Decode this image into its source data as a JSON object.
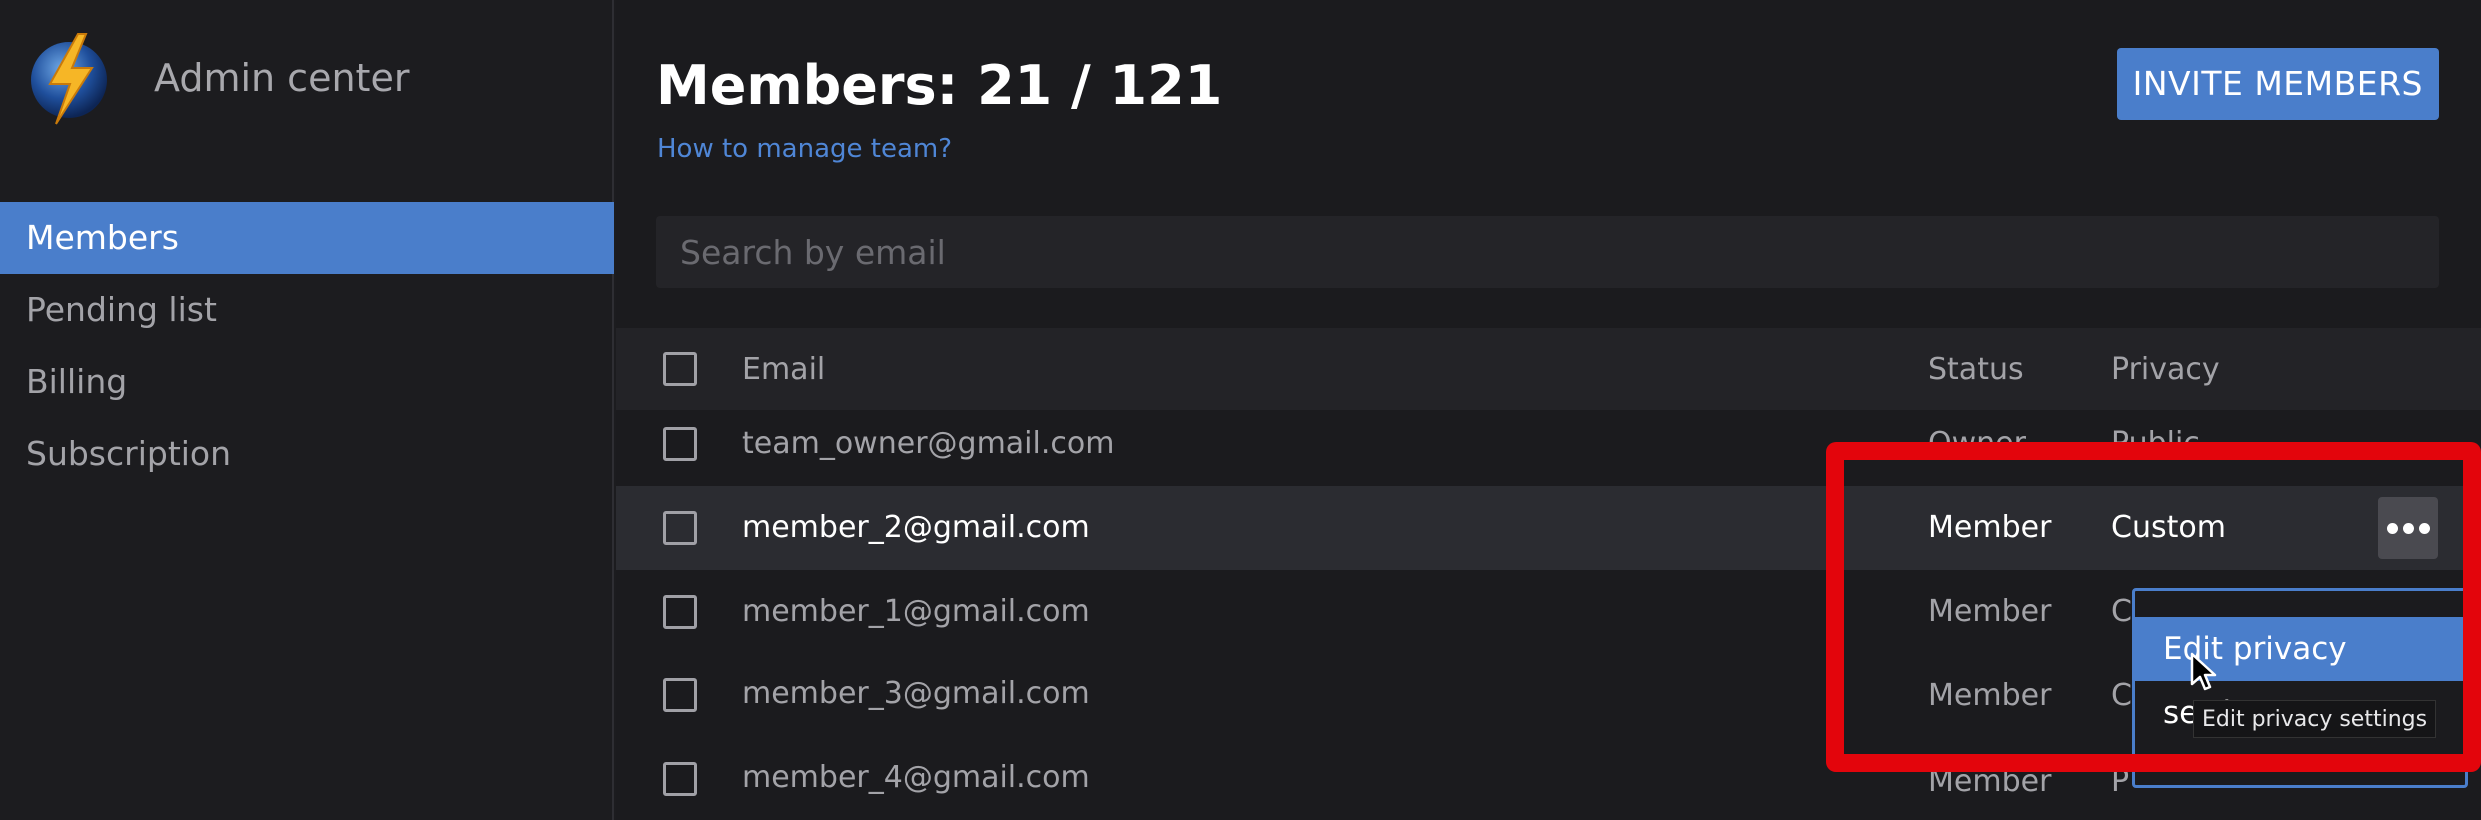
{
  "app": {
    "title": "Admin center"
  },
  "sidebar": {
    "items": [
      {
        "label": "Members",
        "active": true
      },
      {
        "label": "Pending list"
      },
      {
        "label": "Billing"
      },
      {
        "label": "Subscription"
      }
    ]
  },
  "header": {
    "title": "Members: 21 / 121",
    "help_link": "How to manage team?",
    "invite_label": "INVITE MEMBERS"
  },
  "search": {
    "placeholder": "Search by email",
    "value": ""
  },
  "table": {
    "columns": {
      "email": "Email",
      "status": "Status",
      "privacy": "Privacy"
    },
    "rows": [
      {
        "email": "team_owner@gmail.com",
        "status": "Owner",
        "privacy": "Public"
      },
      {
        "email": "member_2@gmail.com",
        "status": "Member",
        "privacy": "Custom"
      },
      {
        "email": "member_1@gmail.com",
        "status": "Member",
        "privacy": "C"
      },
      {
        "email": "member_3@gmail.com",
        "status": "Member",
        "privacy": "C"
      },
      {
        "email": "member_4@gmail.com",
        "status": "Member",
        "privacy": "P"
      }
    ]
  },
  "menu": {
    "item_label": "Edit privacy settings",
    "tooltip": "Edit privacy settings"
  },
  "colors": {
    "accent": "#4a7ecb",
    "highlight": "#e3050c",
    "background": "#1b1b1e"
  },
  "icons": {
    "logo": "lightning-globe-icon",
    "more": "more-dots-icon",
    "cursor": "cursor-icon"
  }
}
